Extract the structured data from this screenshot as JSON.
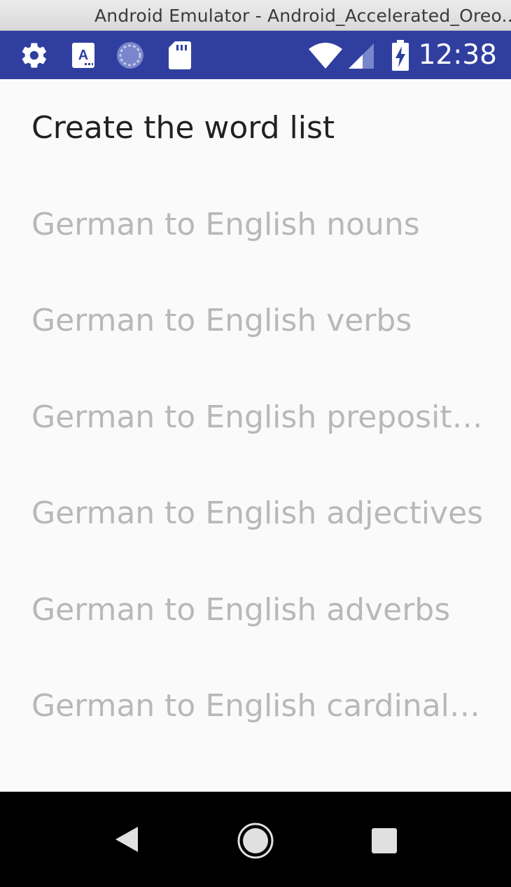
{
  "window": {
    "title": "Android Emulator - Android_Accelerated_Oreo..."
  },
  "status_bar": {
    "time": "12:38",
    "icons": [
      "gear-icon",
      "keyboard-a-icon",
      "sync-circle-icon",
      "sd-card-icon",
      "wifi-icon",
      "signal-icon",
      "battery-charging-icon"
    ],
    "bg_color": "#303f9f"
  },
  "page": {
    "heading": "Create the word list",
    "items": [
      "German to English nouns",
      "German to English verbs",
      "German to English prepositions",
      "German to English adjectives",
      "German to English adverbs",
      "German to English cardinal nu.."
    ]
  },
  "nav_bar": {
    "icons": [
      "back-icon",
      "home-icon",
      "recents-icon"
    ]
  }
}
